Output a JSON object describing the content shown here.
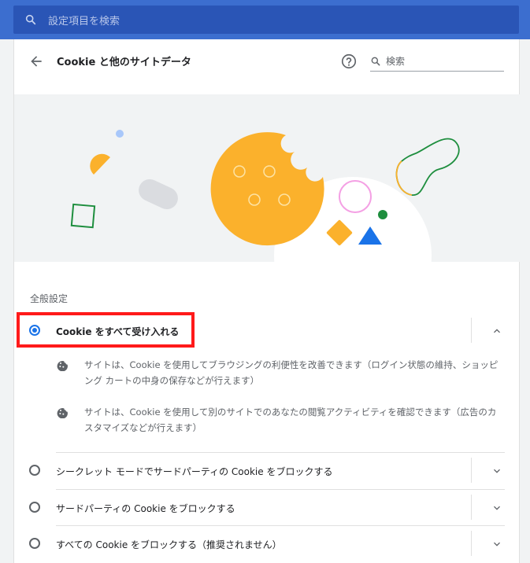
{
  "topbar": {
    "search_placeholder": "設定項目を検索",
    "search_icon": "search-icon"
  },
  "header": {
    "back_icon": "arrow-back-icon",
    "title": "Cookie と他のサイトデータ",
    "help_icon": "help-icon",
    "search_placeholder": "検索",
    "search_icon": "search-icon"
  },
  "section": {
    "label": "全般設定"
  },
  "options": [
    {
      "label": "Cookie をすべて受け入れる",
      "selected": true,
      "expanded": true
    },
    {
      "label": "シークレット モードでサードパーティの Cookie をブロックする",
      "selected": false,
      "expanded": false
    },
    {
      "label": "サードパーティの Cookie をブロックする",
      "selected": false,
      "expanded": false
    },
    {
      "label": "すべての Cookie をブロックする（推奨されません）",
      "selected": false,
      "expanded": false
    }
  ],
  "details": [
    {
      "icon": "cookie-icon",
      "text": "サイトは、Cookie を使用してブラウジングの利便性を改善できます（ログイン状態の維持、ショッピング カートの中身の保存などが行えます）"
    },
    {
      "icon": "cookie-icon",
      "text": "サイトは、Cookie を使用して別のサイトでのあなたの閲覧アクティビティを確認できます（広告のカスタマイズなどが行えます）"
    }
  ],
  "colors": {
    "topbar": "#3c6ecf",
    "accent": "#1a73e8",
    "highlight": "#ff1a1a",
    "cookie": "#fbb12c"
  }
}
